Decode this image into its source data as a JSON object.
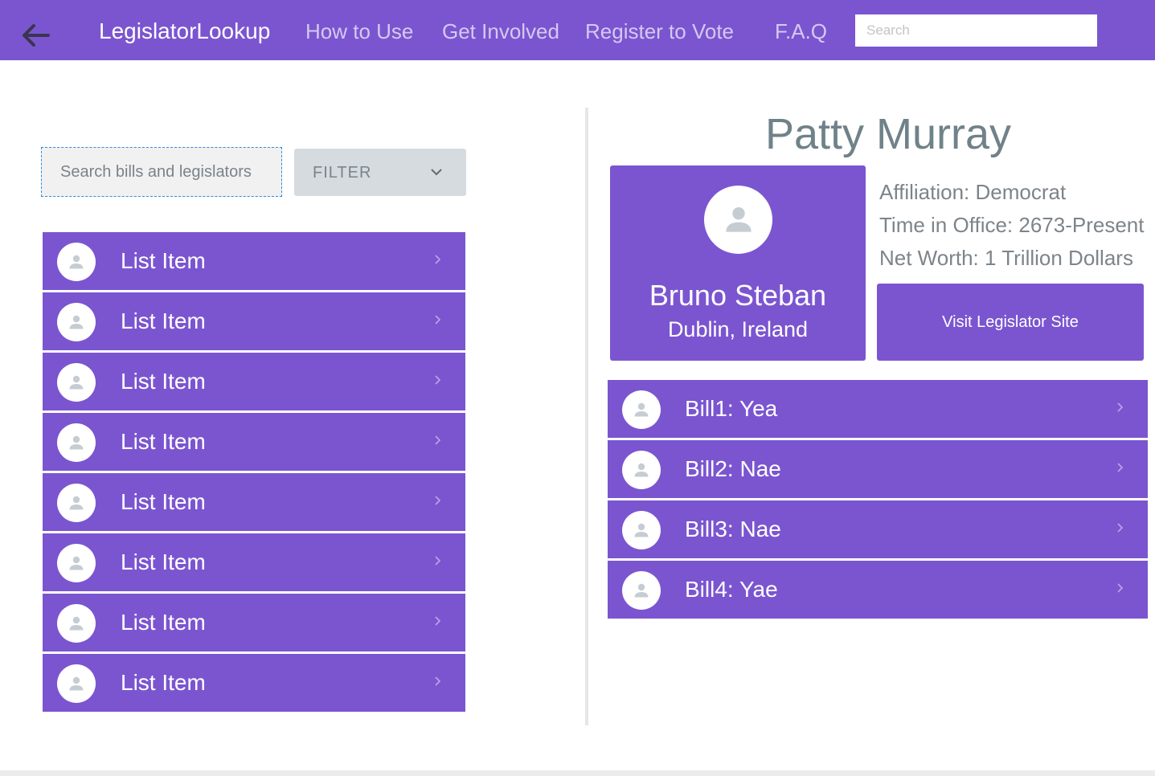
{
  "nav": {
    "back_icon": "arrow-left-icon",
    "brand": "LegislatorLookup",
    "links": [
      "How to Use",
      "Get Involved",
      "Register to Vote",
      "F.A.Q"
    ],
    "search_placeholder": "Search"
  },
  "sidebar": {
    "search_placeholder": "Search bills and legislators",
    "filter_label": "FILTER",
    "filter_icon": "chevron-down-icon",
    "items": [
      {
        "label": "List Item"
      },
      {
        "label": "List Item"
      },
      {
        "label": "List Item"
      },
      {
        "label": "List Item"
      },
      {
        "label": "List Item"
      },
      {
        "label": "List Item"
      },
      {
        "label": "List Item"
      },
      {
        "label": "List Item"
      }
    ]
  },
  "legislator": {
    "name": "Patty Murray",
    "card_name": "Bruno Steban",
    "card_location": "Dublin, Ireland",
    "affiliation": "Affiliation: Democrat",
    "time_in_office": "Time in Office: 2673-Present",
    "net_worth": "Net Worth: 1 Trillion Dollars",
    "visit_button": "Visit Legislator Site",
    "bills": [
      {
        "label": "Bill1: Yea"
      },
      {
        "label": "Bill2: Nae"
      },
      {
        "label": "Bill3: Nae"
      },
      {
        "label": "Bill4: Yae"
      }
    ]
  },
  "colors": {
    "primary": "#7b55d0",
    "heading": "#708289",
    "info_text": "#7d848a",
    "filter_bg": "#d6dbe0"
  }
}
